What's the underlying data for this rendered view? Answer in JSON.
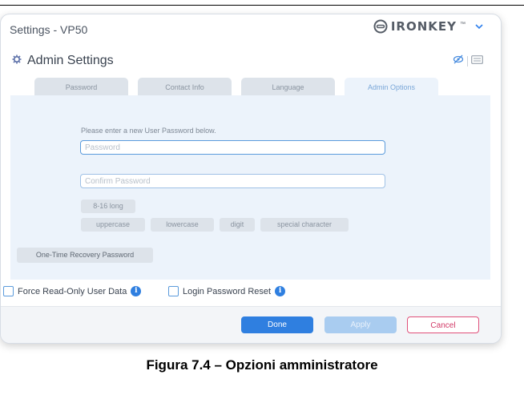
{
  "window": {
    "title": "Settings - VP50",
    "logo_text": "IRONKEY",
    "logo_tm": "™"
  },
  "header": {
    "title": "Admin Settings"
  },
  "tabs": [
    {
      "label": "Password",
      "active": false
    },
    {
      "label": "Contact Info",
      "active": false
    },
    {
      "label": "Language",
      "active": false
    },
    {
      "label": "Admin Options",
      "active": true
    }
  ],
  "panel": {
    "instruction": "Please enter a new User Password below.",
    "password_placeholder": "Password",
    "confirm_placeholder": "Confirm Password",
    "rules": {
      "length": "8-16 long",
      "uppercase": "uppercase",
      "lowercase": "lowercase",
      "digit": "digit",
      "special": "special character"
    },
    "otr_label": "One-Time Recovery Password"
  },
  "options": {
    "force_readonly": "Force Read-Only User Data",
    "login_reset": "Login Password Reset",
    "info_glyph": "i"
  },
  "buttons": {
    "done": "Done",
    "apply": "Apply",
    "cancel": "Cancel"
  },
  "caption": "Figura 7.4 – Opzioni amministratore",
  "colors": {
    "accent": "#2f7fe0",
    "cancel": "#e0507a",
    "panel": "#ecf3fb"
  },
  "icons": [
    "ironkey-logo-icon",
    "chevron-down-icon",
    "gear-icon",
    "eye-off-icon",
    "keyboard-icon",
    "info-icon"
  ]
}
